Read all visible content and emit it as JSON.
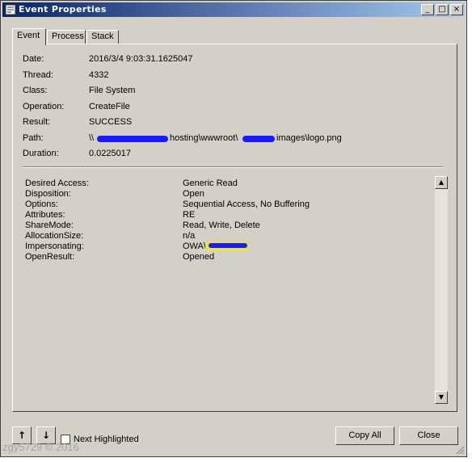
{
  "window": {
    "title": "Event Properties"
  },
  "titlebar_buttons": {
    "minimize": "_",
    "maximize": "□",
    "close": "×"
  },
  "tabs": [
    {
      "label": "Event",
      "active": true
    },
    {
      "label": "Process",
      "active": false
    },
    {
      "label": "Stack",
      "active": false
    }
  ],
  "event": {
    "date_label": "Date:",
    "date_value": "2016/3/4 9:03:31.1625047",
    "thread_label": "Thread:",
    "thread_value": "4332",
    "class_label": "Class:",
    "class_value": "File System",
    "operation_label": "Operation:",
    "operation_value": "CreateFile",
    "result_label": "Result:",
    "result_value": "SUCCESS",
    "path_label": "Path:",
    "path_prefix": "\\\\",
    "path_mid": "hosting\\wwwroot\\",
    "path_suffix": "images\\logo.png",
    "duration_label": "Duration:",
    "duration_value": "0.0225017"
  },
  "details": [
    {
      "key": "Desired Access:",
      "value": "Generic Read"
    },
    {
      "key": "Disposition:",
      "value": "Open"
    },
    {
      "key": "Options:",
      "value": "Sequential Access, No Buffering"
    },
    {
      "key": "Attributes:",
      "value": "RE"
    },
    {
      "key": "ShareMode:",
      "value": "Read, Write, Delete"
    },
    {
      "key": "AllocationSize:",
      "value": "n/a"
    },
    {
      "key": "Impersonating:",
      "value": "OWA\\"
    },
    {
      "key": "OpenResult:",
      "value": "Opened"
    }
  ],
  "footer": {
    "up_arrow": "↑",
    "down_arrow": "↓",
    "next_highlighted_label": "Next Highlighted",
    "copy_all_label": "Copy All",
    "close_label": "Close",
    "watermark": "zgy5729 © 2016"
  },
  "colors": {
    "titlebar_start": "#0a246a",
    "titlebar_end": "#a6caf0",
    "redaction": "#1a1aff",
    "highlight": "#e8e830"
  }
}
